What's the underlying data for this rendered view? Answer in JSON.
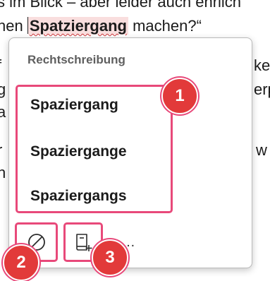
{
  "document": {
    "line1_text": "s im Blick – aber leider auch ehrlich",
    "line2_before": "hen ",
    "misspelled_word": "Spatziergang",
    "line2_after": " machen?“",
    "left_fragments": [
      "f",
      "g",
      "a",
      "r",
      "n"
    ],
    "right_fragments": [
      "ke",
      "erp",
      "w"
    ]
  },
  "popup": {
    "title": "Rechtschreibung",
    "suggestions": [
      "Spaziergang",
      "Spaziergange",
      "Spaziergangs"
    ],
    "more_label": "…"
  },
  "annotations": {
    "badge_1": "1",
    "badge_2": "2",
    "badge_3": "3",
    "highlight_color": "#e8497a",
    "badge_color": "#e23a3a"
  },
  "icons": {
    "ignore": "ignore-icon",
    "add_to_dictionary": "add-to-dictionary-icon",
    "more": "more-options-icon"
  }
}
